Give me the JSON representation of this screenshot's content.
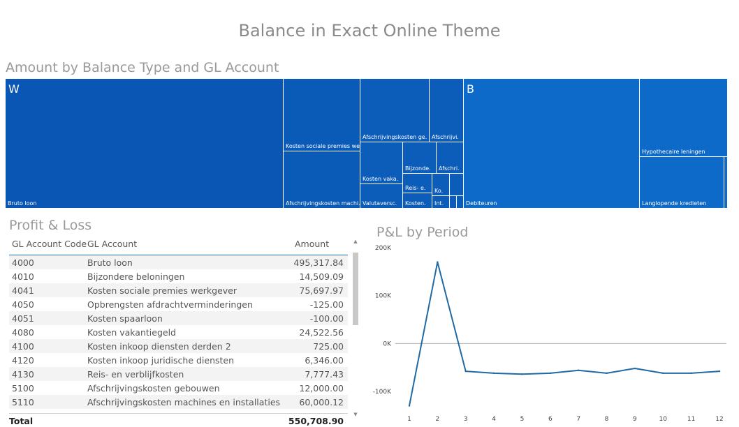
{
  "page_title": "Balance in Exact Online Theme",
  "treemap": {
    "title": "Amount by Balance Type and GL Account",
    "groups": [
      "W",
      "B"
    ],
    "tiles": [
      {
        "label": "Bruto loon",
        "color": "#0a56b4"
      },
      {
        "label": "Kosten sociale premies we.",
        "color": "#0a5ab8"
      },
      {
        "label": "Afschrijvingskosten machi.",
        "color": "#0a5ab8"
      },
      {
        "label": "Afschrijvingskosten ge.",
        "color": "#0c5dba"
      },
      {
        "label": "Afschrijvi.",
        "color": "#0c5dba"
      },
      {
        "label": "Kosten vaka.",
        "color": "#0c5dba"
      },
      {
        "label": "Valutaversc.",
        "color": "#0c5dba"
      },
      {
        "label": "Bijzonde.",
        "color": "#0c5dba"
      },
      {
        "label": "Afschri.",
        "color": "#0c5dba"
      },
      {
        "label": "Reis- e.",
        "color": "#0c5dba"
      },
      {
        "label": "Kosten.",
        "color": "#0c5dba"
      },
      {
        "label": "Ko.",
        "color": "#0c5dba"
      },
      {
        "label": "Int.",
        "color": "#0c5dba"
      },
      {
        "label": "",
        "color": "#0c5dba"
      },
      {
        "label": "",
        "color": "#0c5dba"
      },
      {
        "label": "",
        "color": "#0c5dba"
      },
      {
        "label": "Debiteuren",
        "color": "#0e6ac8"
      },
      {
        "label": "Hypothecaire leningen",
        "color": "#0e6ac8"
      },
      {
        "label": "Langlopende kredieten",
        "color": "#0e6ac8"
      },
      {
        "label": "",
        "color": "#0e6ac8"
      }
    ]
  },
  "table": {
    "title": "Profit & Loss",
    "headers": {
      "code": "GL Account Code",
      "account": "GL Account",
      "amount": "Amount"
    },
    "rows": [
      {
        "code": "4000",
        "account": "Bruto loon",
        "amount": "495,317.84"
      },
      {
        "code": "4010",
        "account": "Bijzondere beloningen",
        "amount": "14,509.09"
      },
      {
        "code": "4041",
        "account": "Kosten sociale premies werkgever",
        "amount": "75,697.97"
      },
      {
        "code": "4050",
        "account": "Opbrengsten afdrachtverminderingen",
        "amount": "-125.00"
      },
      {
        "code": "4051",
        "account": "Kosten spaarloon",
        "amount": "-100.00"
      },
      {
        "code": "4080",
        "account": "Kosten vakantiegeld",
        "amount": "24,522.56"
      },
      {
        "code": "4100",
        "account": "Kosten inkoop diensten derden 2",
        "amount": "725.00"
      },
      {
        "code": "4120",
        "account": "Kosten inkoop juridische diensten",
        "amount": "6,346.00"
      },
      {
        "code": "4130",
        "account": "Reis- en verblijfkosten",
        "amount": "7,777.43"
      },
      {
        "code": "5100",
        "account": "Afschrijvingskosten gebouwen",
        "amount": "12,000.00"
      },
      {
        "code": "5110",
        "account": "Afschrijvingskosten machines en installaties",
        "amount": "60,000.12"
      }
    ],
    "total_label": "Total",
    "total_amount": "550,708.90"
  },
  "chart_data": {
    "type": "line",
    "title": "P&L by Period",
    "xlabel": "",
    "ylabel": "",
    "x": [
      1,
      2,
      3,
      4,
      5,
      6,
      7,
      8,
      9,
      10,
      11,
      12
    ],
    "series": [
      {
        "values": [
          -130000,
          170000,
          -58000,
          -62000,
          -64000,
          -62000,
          -56000,
          -62000,
          -52000,
          -62000,
          -62000,
          -58000
        ]
      }
    ],
    "ylim": [
      -135000,
      200000
    ],
    "yticks": [
      200000,
      100000,
      0,
      -100000
    ],
    "ytick_labels": [
      "200K",
      "100K",
      "0K",
      "-100K"
    ],
    "zero_line": true,
    "line_color": "#1f6aa5",
    "zero_line_color": "#b0b0b0"
  }
}
